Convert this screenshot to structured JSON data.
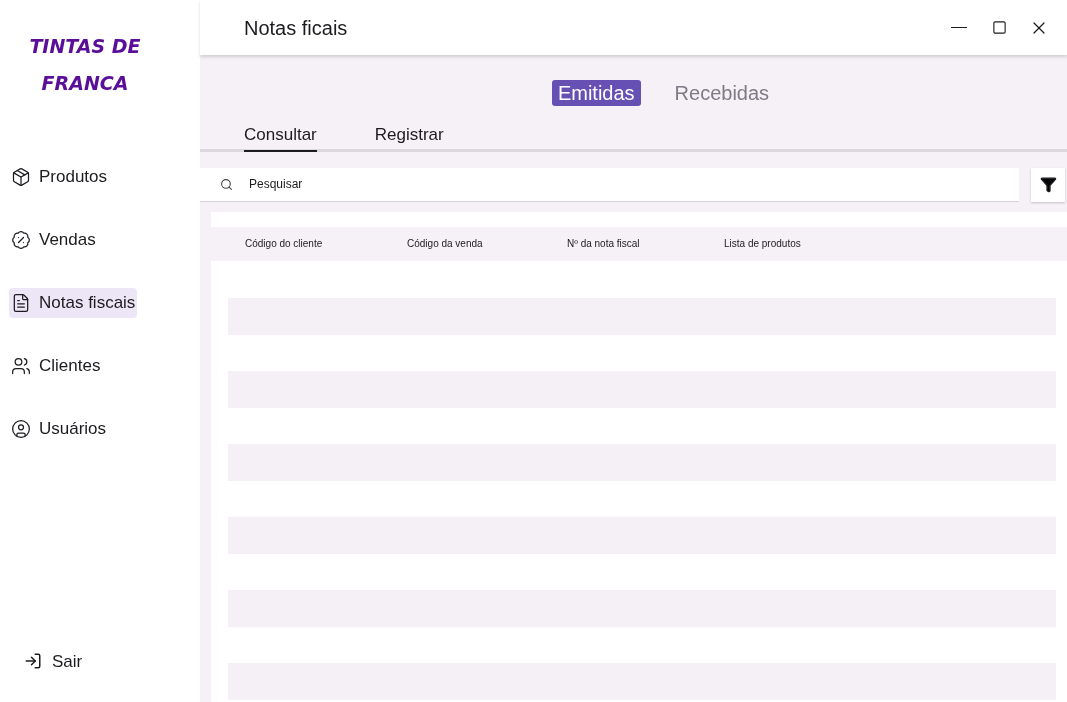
{
  "logo": {
    "lines": [
      "TINTAS DE",
      "FRANCA"
    ]
  },
  "sidebar": {
    "items": [
      {
        "label": "Produtos",
        "selected": false
      },
      {
        "label": "Vendas",
        "selected": false
      },
      {
        "label": "Notas fiscais",
        "selected": true
      },
      {
        "label": "Clientes",
        "selected": false
      },
      {
        "label": "Usuários",
        "selected": false
      }
    ],
    "logout": {
      "label": "Sair"
    }
  },
  "window": {
    "title": "Notas ficais"
  },
  "tabs": [
    {
      "label": "Emitidas",
      "selected": true
    },
    {
      "label": "Recebidas",
      "selected": false
    }
  ],
  "subtabs": [
    {
      "label": "Consultar",
      "selected": true
    },
    {
      "label": "Registrar",
      "selected": false
    }
  ],
  "search": {
    "placeholder": "Pesquisar"
  },
  "table": {
    "columns": [
      "Código do cliente",
      "Código da venda",
      "Nº da nota fiscal",
      "Lista de produtos"
    ]
  }
}
